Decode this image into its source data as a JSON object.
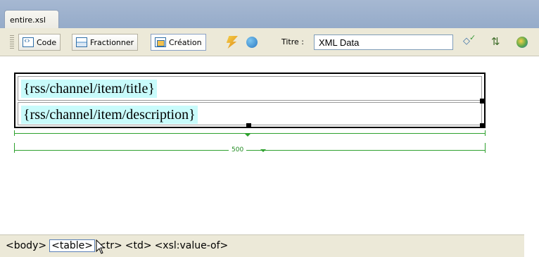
{
  "document_tab": {
    "label": "entire.xsl"
  },
  "toolbar": {
    "code_label": "Code",
    "split_label": "Fractionner",
    "design_label": "Création",
    "title_label": "Titre :",
    "title_value": "XML Data"
  },
  "design": {
    "row1_binding": "{rss/channel/item/title}",
    "row2_binding": "{rss/channel/item/description}",
    "table_width": "500"
  },
  "tag_selector": {
    "tags": [
      "<body>",
      "<table>",
      "<tr>",
      "<td>",
      "<xsl:value-of>"
    ],
    "selected_index": 1
  },
  "colors": {
    "tab_strip": "#a6b8d2",
    "panel": "#ece9d8",
    "binding_highlight": "#c8fbfb",
    "width_guide": "#2ea12e"
  }
}
